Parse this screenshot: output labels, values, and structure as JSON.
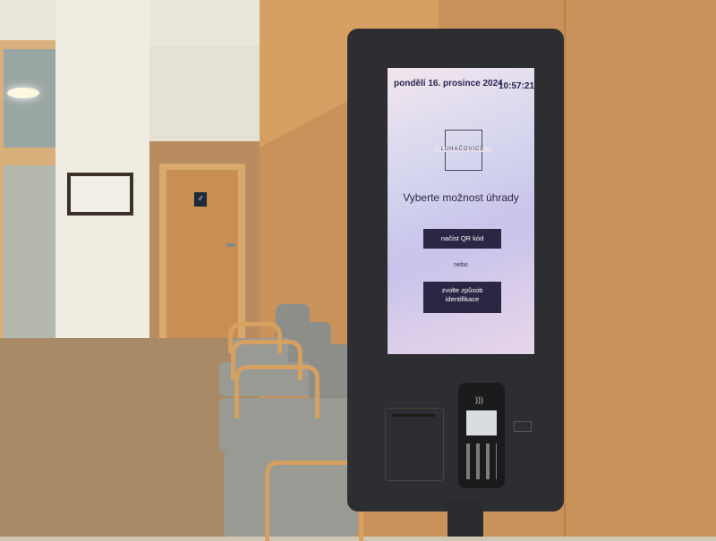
{
  "kiosk": {
    "date": "pondělí 16. prosince 2024",
    "time": "10:57:21",
    "logo_text": "LUHAČOVICE",
    "heading": "Vyberte možnost úhrady",
    "qr_button": "načíst QR kód",
    "or_text": "nebo",
    "id_button_line1": "zvolte způsob",
    "id_button_line2": "identifikace"
  }
}
